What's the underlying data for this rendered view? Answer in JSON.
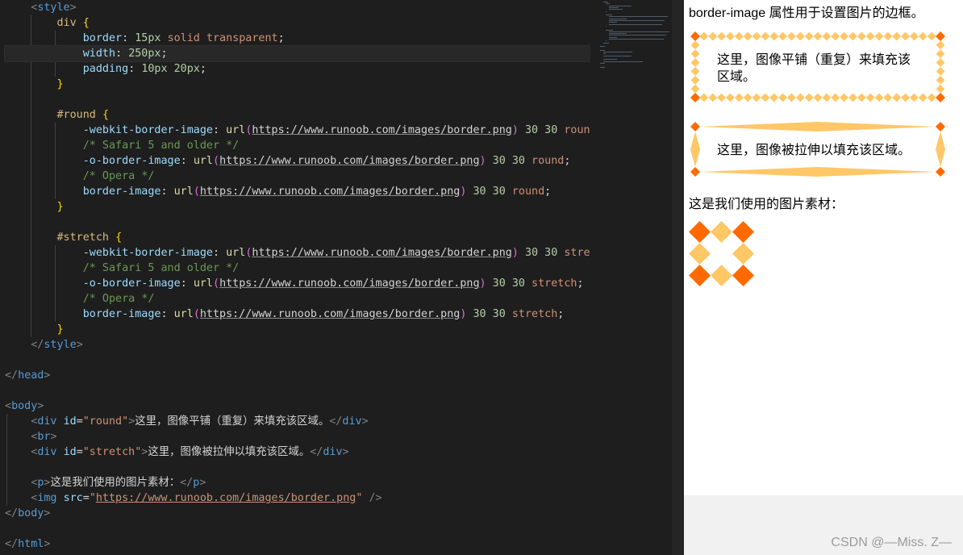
{
  "editor": {
    "lines": [
      [
        [
          "    ",
          "text"
        ],
        [
          "<",
          "punct"
        ],
        [
          "style",
          "tag"
        ],
        [
          ">",
          "punct"
        ]
      ],
      [
        [
          "        ",
          "text"
        ],
        [
          "div",
          "sel"
        ],
        [
          " ",
          "text"
        ],
        [
          "{",
          "brace"
        ]
      ],
      [
        [
          "            ",
          "text"
        ],
        [
          "border",
          "prop"
        ],
        [
          ": ",
          "text"
        ],
        [
          "15px",
          "num"
        ],
        [
          " ",
          "text"
        ],
        [
          "solid",
          "val"
        ],
        [
          " ",
          "text"
        ],
        [
          "transparent",
          "val"
        ],
        [
          ";",
          "text"
        ]
      ],
      [
        [
          "            ",
          "text"
        ],
        [
          "width",
          "prop"
        ],
        [
          ": ",
          "text"
        ],
        [
          "250px",
          "num"
        ],
        [
          ";",
          "text"
        ]
      ],
      [
        [
          "            ",
          "text"
        ],
        [
          "padding",
          "prop"
        ],
        [
          ": ",
          "text"
        ],
        [
          "10px",
          "num"
        ],
        [
          " ",
          "text"
        ],
        [
          "20px",
          "num"
        ],
        [
          ";",
          "text"
        ]
      ],
      [
        [
          "        ",
          "text"
        ],
        [
          "}",
          "brace"
        ]
      ],
      [
        [
          "",
          "text"
        ]
      ],
      [
        [
          "        ",
          "text"
        ],
        [
          "#round",
          "sel"
        ],
        [
          " ",
          "text"
        ],
        [
          "{",
          "brace"
        ]
      ],
      [
        [
          "            ",
          "text"
        ],
        [
          "-webkit-border-image",
          "prop"
        ],
        [
          ": ",
          "text"
        ],
        [
          "url",
          "fn"
        ],
        [
          "(",
          "paren"
        ],
        [
          "https://www.runoob.com/images/border.png",
          "url"
        ],
        [
          ")",
          "paren"
        ],
        [
          " ",
          "text"
        ],
        [
          "30",
          "num"
        ],
        [
          " ",
          "text"
        ],
        [
          "30",
          "num"
        ],
        [
          " ",
          "text"
        ],
        [
          "round",
          "val"
        ],
        [
          ";",
          "text"
        ]
      ],
      [
        [
          "            ",
          "text"
        ],
        [
          "/* Safari 5 and older */",
          "cmt"
        ]
      ],
      [
        [
          "            ",
          "text"
        ],
        [
          "-o-border-image",
          "prop"
        ],
        [
          ": ",
          "text"
        ],
        [
          "url",
          "fn"
        ],
        [
          "(",
          "paren"
        ],
        [
          "https://www.runoob.com/images/border.png",
          "url"
        ],
        [
          ")",
          "paren"
        ],
        [
          " ",
          "text"
        ],
        [
          "30",
          "num"
        ],
        [
          " ",
          "text"
        ],
        [
          "30",
          "num"
        ],
        [
          " ",
          "text"
        ],
        [
          "round",
          "val"
        ],
        [
          ";",
          "text"
        ]
      ],
      [
        [
          "            ",
          "text"
        ],
        [
          "/* Opera */",
          "cmt"
        ]
      ],
      [
        [
          "            ",
          "text"
        ],
        [
          "border-image",
          "prop"
        ],
        [
          ": ",
          "text"
        ],
        [
          "url",
          "fn"
        ],
        [
          "(",
          "paren"
        ],
        [
          "https://www.runoob.com/images/border.png",
          "url"
        ],
        [
          ")",
          "paren"
        ],
        [
          " ",
          "text"
        ],
        [
          "30",
          "num"
        ],
        [
          " ",
          "text"
        ],
        [
          "30",
          "num"
        ],
        [
          " ",
          "text"
        ],
        [
          "round",
          "val"
        ],
        [
          ";",
          "text"
        ]
      ],
      [
        [
          "        ",
          "text"
        ],
        [
          "}",
          "brace"
        ]
      ],
      [
        [
          "",
          "text"
        ]
      ],
      [
        [
          "        ",
          "text"
        ],
        [
          "#stretch",
          "sel"
        ],
        [
          " ",
          "text"
        ],
        [
          "{",
          "brace"
        ]
      ],
      [
        [
          "            ",
          "text"
        ],
        [
          "-webkit-border-image",
          "prop"
        ],
        [
          ": ",
          "text"
        ],
        [
          "url",
          "fn"
        ],
        [
          "(",
          "paren"
        ],
        [
          "https://www.runoob.com/images/border.png",
          "url"
        ],
        [
          ")",
          "paren"
        ],
        [
          " ",
          "text"
        ],
        [
          "30",
          "num"
        ],
        [
          " ",
          "text"
        ],
        [
          "30",
          "num"
        ],
        [
          " ",
          "text"
        ],
        [
          "stretch",
          "val"
        ],
        [
          ";",
          "text"
        ]
      ],
      [
        [
          "            ",
          "text"
        ],
        [
          "/* Safari 5 and older */",
          "cmt"
        ]
      ],
      [
        [
          "            ",
          "text"
        ],
        [
          "-o-border-image",
          "prop"
        ],
        [
          ": ",
          "text"
        ],
        [
          "url",
          "fn"
        ],
        [
          "(",
          "paren"
        ],
        [
          "https://www.runoob.com/images/border.png",
          "url"
        ],
        [
          ")",
          "paren"
        ],
        [
          " ",
          "text"
        ],
        [
          "30",
          "num"
        ],
        [
          " ",
          "text"
        ],
        [
          "30",
          "num"
        ],
        [
          " ",
          "text"
        ],
        [
          "stretch",
          "val"
        ],
        [
          ";",
          "text"
        ]
      ],
      [
        [
          "            ",
          "text"
        ],
        [
          "/* Opera */",
          "cmt"
        ]
      ],
      [
        [
          "            ",
          "text"
        ],
        [
          "border-image",
          "prop"
        ],
        [
          ": ",
          "text"
        ],
        [
          "url",
          "fn"
        ],
        [
          "(",
          "paren"
        ],
        [
          "https://www.runoob.com/images/border.png",
          "url"
        ],
        [
          ")",
          "paren"
        ],
        [
          " ",
          "text"
        ],
        [
          "30",
          "num"
        ],
        [
          " ",
          "text"
        ],
        [
          "30",
          "num"
        ],
        [
          " ",
          "text"
        ],
        [
          "stretch",
          "val"
        ],
        [
          ";",
          "text"
        ]
      ],
      [
        [
          "        ",
          "text"
        ],
        [
          "}",
          "brace"
        ]
      ],
      [
        [
          "    ",
          "text"
        ],
        [
          "</",
          "punct"
        ],
        [
          "style",
          "tag"
        ],
        [
          ">",
          "punct"
        ]
      ],
      [
        [
          "",
          "text"
        ]
      ],
      [
        [
          "</",
          "punct"
        ],
        [
          "head",
          "tag"
        ],
        [
          ">",
          "punct"
        ]
      ],
      [
        [
          "",
          "text"
        ]
      ],
      [
        [
          "<",
          "punct"
        ],
        [
          "body",
          "tag"
        ],
        [
          ">",
          "punct"
        ]
      ],
      [
        [
          "    ",
          "text"
        ],
        [
          "<",
          "punct"
        ],
        [
          "div",
          "tag"
        ],
        [
          " ",
          "text"
        ],
        [
          "id",
          "attr"
        ],
        [
          "=",
          "text"
        ],
        [
          "\"round\"",
          "str"
        ],
        [
          ">",
          "punct"
        ],
        [
          "这里，图像平铺（重复）来填充该区域。",
          "text"
        ],
        [
          "</",
          "punct"
        ],
        [
          "div",
          "tag"
        ],
        [
          ">",
          "punct"
        ]
      ],
      [
        [
          "    ",
          "text"
        ],
        [
          "<",
          "punct"
        ],
        [
          "br",
          "tag"
        ],
        [
          ">",
          "punct"
        ]
      ],
      [
        [
          "    ",
          "text"
        ],
        [
          "<",
          "punct"
        ],
        [
          "div",
          "tag"
        ],
        [
          " ",
          "text"
        ],
        [
          "id",
          "attr"
        ],
        [
          "=",
          "text"
        ],
        [
          "\"stretch\"",
          "str"
        ],
        [
          ">",
          "punct"
        ],
        [
          "这里，图像被拉伸以填充该区域。",
          "text"
        ],
        [
          "</",
          "punct"
        ],
        [
          "div",
          "tag"
        ],
        [
          ">",
          "punct"
        ]
      ],
      [
        [
          "",
          "text"
        ]
      ],
      [
        [
          "    ",
          "text"
        ],
        [
          "<",
          "punct"
        ],
        [
          "p",
          "tag"
        ],
        [
          ">",
          "punct"
        ],
        [
          "这是我们使用的图片素材：",
          "text"
        ],
        [
          "</",
          "punct"
        ],
        [
          "p",
          "tag"
        ],
        [
          ">",
          "punct"
        ]
      ],
      [
        [
          "    ",
          "text"
        ],
        [
          "<",
          "punct"
        ],
        [
          "img",
          "tag"
        ],
        [
          " ",
          "text"
        ],
        [
          "src",
          "attr"
        ],
        [
          "=",
          "text"
        ],
        [
          "\"",
          "str"
        ],
        [
          "https://www.runoob.com/images/border.png",
          "strurl"
        ],
        [
          "\"",
          "str"
        ],
        [
          " />",
          "punct"
        ]
      ],
      [
        [
          "</",
          "punct"
        ],
        [
          "body",
          "tag"
        ],
        [
          ">",
          "punct"
        ]
      ],
      [
        [
          "",
          "text"
        ]
      ],
      [
        [
          "</",
          "punct"
        ],
        [
          "html",
          "tag"
        ],
        [
          ">",
          "punct"
        ]
      ]
    ],
    "current_line": 3
  },
  "preview": {
    "title": "border-image 属性用于设置图片的边框。",
    "round_text": "这里，图像平铺（重复）来填充该区域。",
    "stretch_text": "这里，图像被拉伸以填充该区域。",
    "paragraph": "这是我们使用的图片素材：",
    "colors": {
      "dark": "#ff6a00",
      "light": "#ffc766"
    }
  },
  "watermark": "CSDN @—Miss. Z—"
}
